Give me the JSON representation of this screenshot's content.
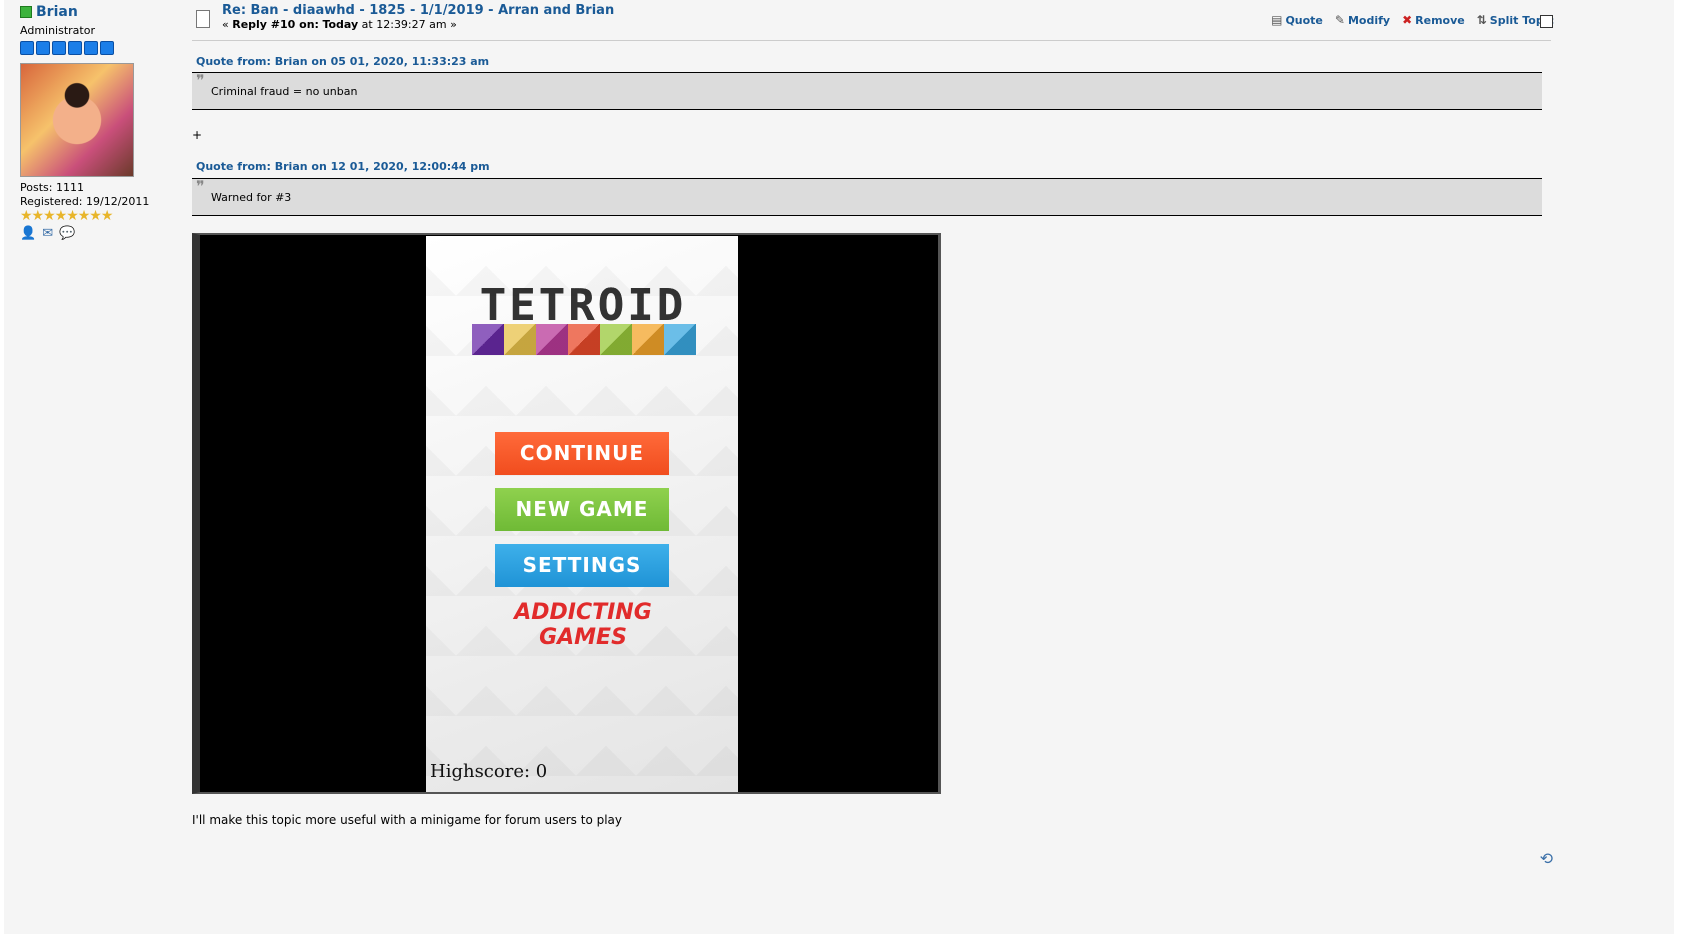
{
  "poster": {
    "name": "Brian",
    "role": "Administrator",
    "posts": "Posts: 1111",
    "registered": "Registered: 19/12/2011",
    "rank_stars": "★★★★★★★★"
  },
  "topic": {
    "title": "Re: Ban - diaawhd - 1825 - 1/1/2019 - Arran and Brian",
    "sub_prefix": "« ",
    "reply_label": "Reply #10 on:",
    "today": "Today",
    "time": " at 12:39:27 am »"
  },
  "actions": {
    "quote": "Quote",
    "modify": "Modify",
    "remove": "Remove",
    "split": "Split Topic"
  },
  "quotes": [
    {
      "header": "Quote from: Brian on 05 01, 2020, 11:33:23 am",
      "text": "Criminal fraud = no unban"
    },
    {
      "header": "Quote from: Brian on 12 01, 2020, 12:00:44 pm",
      "text": "Warned for #3"
    }
  ],
  "plus": "+",
  "game": {
    "logo": "TETROID",
    "continue": "CONTINUE",
    "new_game": "NEW GAME",
    "settings": "SETTINGS",
    "brand": "ADDICTING GAMES",
    "highscore": "Highscore: 0",
    "tile_colors": [
      "#6a2aa8",
      "#e8c24a",
      "#b83a98",
      "#e84a2a",
      "#98c83a",
      "#f3a42a",
      "#3aa8e0"
    ]
  },
  "body_text": "I'll make this topic more useful with a minigame for forum users to play"
}
